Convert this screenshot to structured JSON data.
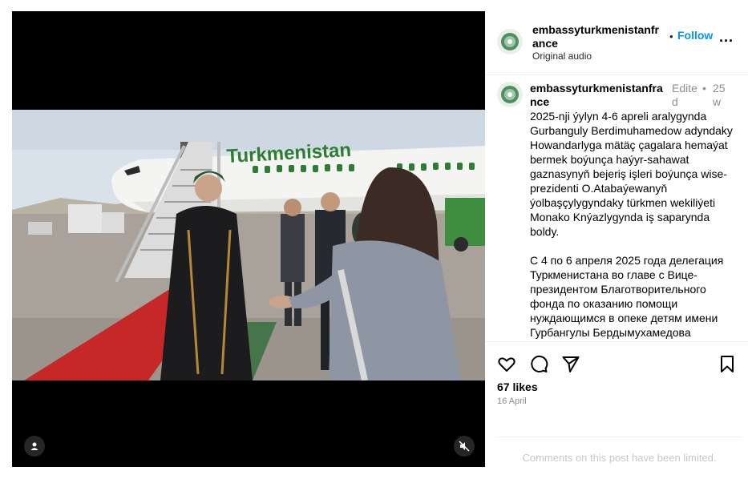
{
  "post": {
    "username": "embassyturkmenistanfrance",
    "follow_label": "Follow",
    "dot": "•",
    "more_label": "...",
    "audio_label": "Original audio"
  },
  "caption": {
    "username": "embassyturkmenistanfrance",
    "edited_label": "Edited",
    "dot": "•",
    "time_ago": "25w",
    "text_tm": "2025-nji ýylyn 4-6 apreli aralygynda Gurbanguly Berdimuhamedow adyndaky Howandarlyga mätäç çagalara hemaýat bermek boýunça haýyr-sahawat gaznasynyň bejeriş işleri boýunça wise-prezidenti O.Atabaýewanyň ýolbaşçylygyndaky türkmen wekiliýeti Monako Knýazlygynda iş saparynda boldy.",
    "text_ru": "С 4 по 6 апреля 2025 года делегация Туркменистана во главе с Вице-президентом Благотворительного фонда по оказанию помощи нуждающимся в опеке детям имени Гурбангулы Бердымухамедова"
  },
  "video": {
    "plane_text": "Turkmenistan"
  },
  "engagement": {
    "likes": "67 likes",
    "date": "16 April",
    "comments_limited": "Comments on this post have been limited."
  },
  "icons": {
    "like": "heart-icon",
    "comment": "comment-icon",
    "share": "send-icon",
    "save": "bookmark-icon",
    "user": "user-icon",
    "mute": "muted-speaker-icon"
  },
  "colors": {
    "follow": "#0095f6",
    "muted_text": "#8e8e8e",
    "limited_text": "#c7c7c7",
    "plane_stripe": "#2e7d32",
    "carpet": "#c62828"
  }
}
